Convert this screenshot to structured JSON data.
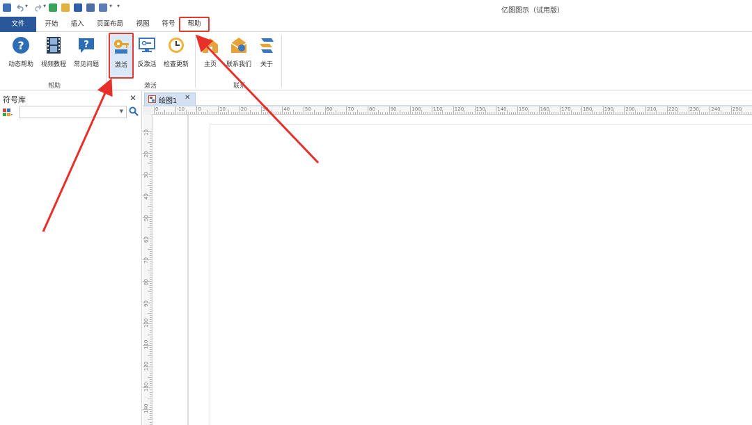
{
  "window": {
    "title": "亿图图示（试用版）"
  },
  "quick_access": {
    "icons": [
      "app-icon",
      "undo-icon",
      "redo-icon",
      "new-icon",
      "open-icon",
      "save-icon",
      "print-icon",
      "export-icon",
      "customize-icon"
    ]
  },
  "menu_tabs": [
    {
      "label": "文件",
      "active": false
    },
    {
      "label": "开始",
      "active": false
    },
    {
      "label": "插入",
      "active": false
    },
    {
      "label": "页面布局",
      "active": false
    },
    {
      "label": "视图",
      "active": false
    },
    {
      "label": "符号",
      "active": false
    },
    {
      "label": "帮助",
      "active": true
    }
  ],
  "ribbon": {
    "groups": [
      {
        "label": "帮助",
        "buttons": [
          {
            "label": "动态帮助",
            "icon": "question-circle-icon"
          },
          {
            "label": "视频教程",
            "icon": "film-icon"
          },
          {
            "label": "常见问题",
            "icon": "faq-bubble-icon"
          }
        ]
      },
      {
        "label": "激活",
        "buttons": [
          {
            "label": "激活",
            "icon": "key-icon"
          },
          {
            "label": "反激活",
            "icon": "monitor-key-icon"
          },
          {
            "label": "检查更新",
            "icon": "clock-icon"
          }
        ]
      },
      {
        "label": "联系",
        "buttons": [
          {
            "label": "主页",
            "icon": "home-icon"
          },
          {
            "label": "联系我们",
            "icon": "contact-envelope-icon"
          },
          {
            "label": "关于",
            "icon": "about-logo-icon"
          }
        ]
      }
    ]
  },
  "symbol_panel": {
    "title": "符号库",
    "search_value": ""
  },
  "document": {
    "tab_label": "绘图1"
  },
  "ruler": {
    "horizontal_labels": [
      "0",
      "-10",
      "0",
      "10",
      "20",
      "30",
      "40",
      "50",
      "60",
      "70",
      "80",
      "90",
      "100",
      "110",
      "120",
      "130",
      "140",
      "150",
      "160",
      "170",
      "180",
      "190",
      "200",
      "210",
      "220",
      "230",
      "240",
      "250",
      "260"
    ],
    "vertical_labels": [
      "10",
      "20",
      "30",
      "40",
      "50",
      "60",
      "70",
      "80",
      "90",
      "100",
      "110",
      "120",
      "130",
      "140"
    ]
  },
  "colors": {
    "file_tab": "#2a579a",
    "highlight_box": "#e23a2e",
    "arrow": "#e8302a",
    "doc_tab": "#d3e1f2"
  }
}
